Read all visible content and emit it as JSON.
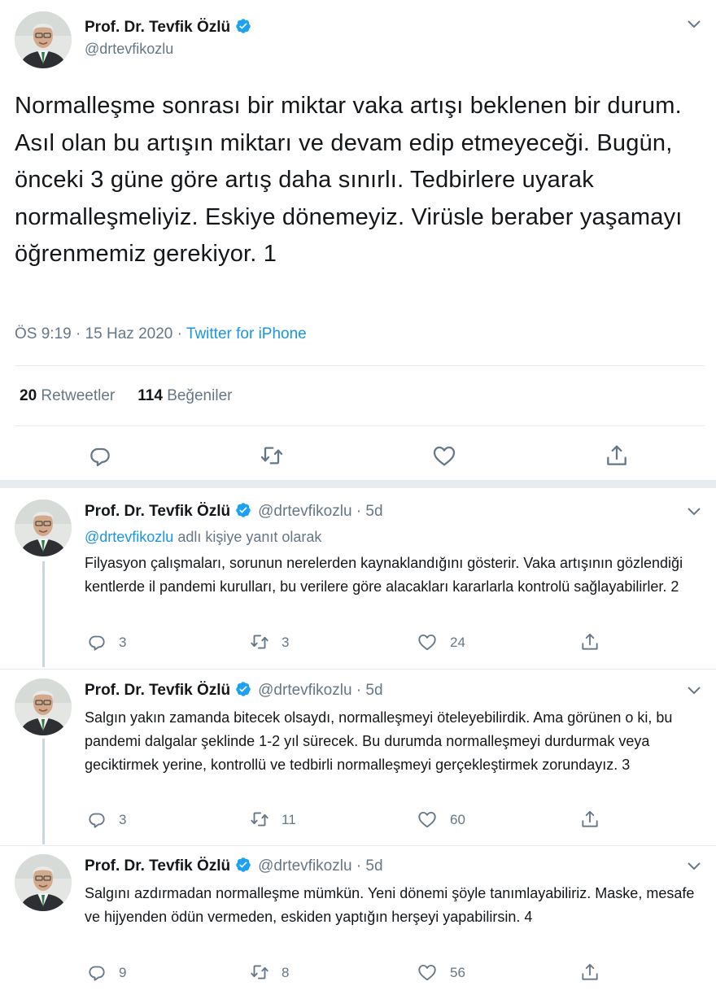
{
  "author": {
    "name": "Prof. Dr. Tevfik Özlü",
    "handle": "@drtevfikozlu"
  },
  "main_tweet": {
    "text": "Normalleşme sonrası bir miktar vaka artışı beklenen bir durum. Asıl olan bu artışın miktarı ve devam edip etmeyeceği. Bugün, önceki 3 güne göre artış daha sınırlı. Tedbirlere uyarak normalleşmeliyiz. Eskiye dönemeyiz. Virüsle beraber yaşamayı öğrenmemiz gerekiyor. 1",
    "time": "ÖS 9:19",
    "date": "15 Haz 2020",
    "source": "Twitter for iPhone",
    "retweets": "20",
    "retweets_label": "Retweetler",
    "likes": "114",
    "likes_label": "Beğeniler"
  },
  "replies": [
    {
      "name": "Prof. Dr. Tevfik Özlü",
      "handle_time": "@drtevfikozlu · 5d",
      "reply_to_mention": "@drtevfikozlu",
      "reply_to_text": " adlı kişiye yanıt olarak",
      "text": "Filyasyon çalışmaları, sorunun nerelerden kaynaklandığını gösterir. Vaka artışının gözlendiği kentlerde il pandemi kurulları, bu verilere göre alacakları kararlarla kontrolü sağlayabilirler. 2",
      "replies": "3",
      "retweets": "3",
      "likes": "24"
    },
    {
      "name": "Prof. Dr. Tevfik Özlü",
      "handle_time": "@drtevfikozlu · 5d",
      "text": "Salgın yakın zamanda bitecek olsaydı, normalleşmeyi öteleyebilirdik. Ama görünen o ki, bu pandemi dalgalar şeklinde 1-2 yıl sürecek. Bu durumda normalleşmeyi durdurmak veya geciktirmek yerine, kontrollü ve tedbirli normalleşmeyi gerçekleştirmek zorundayız. 3",
      "replies": "3",
      "retweets": "11",
      "likes": "60"
    },
    {
      "name": "Prof. Dr. Tevfik Özlü",
      "handle_time": "@drtevfikozlu · 5d",
      "text": "Salgını azdırmadan normalleşme mümkün. Yeni dönemi şöyle tanımlayabiliriz. Maske, mesafe ve hijyenden ödün vermeden, eskiden yaptığın herşeyi yapabilirsin. 4",
      "replies": "9",
      "retweets": "8",
      "likes": "56"
    }
  ],
  "icons": {
    "verified": "verified-badge-icon",
    "menu": "chevron-down-icon",
    "reply": "reply-icon",
    "retweet": "retweet-icon",
    "like": "heart-icon",
    "share": "share-icon"
  },
  "colors": {
    "accent": "#1b95e0",
    "verified": "#1da1f2",
    "muted": "#657786"
  }
}
